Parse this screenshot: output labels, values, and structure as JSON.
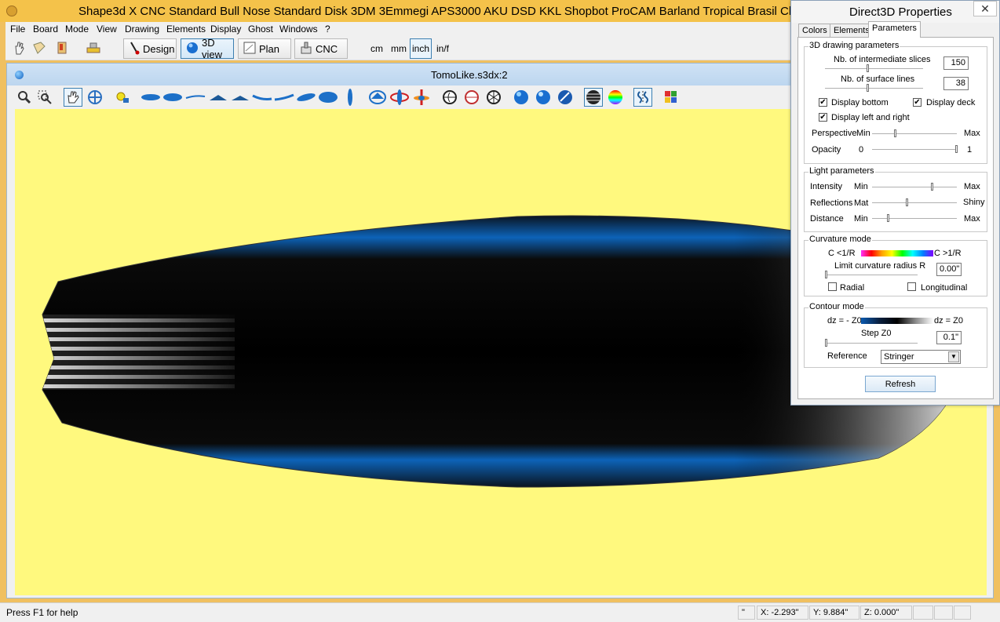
{
  "app": {
    "title": "Shape3d X CNC  Standard Bull Nose Standard Disk 3DM 3Emmegi APS3000 AKU DSD KKL Shopbot ProCAM Barland Tropical Brasil Channel Islands"
  },
  "menu": [
    "File",
    "Board",
    "Mode",
    "View",
    "Drawing",
    "Elements",
    "Display",
    "Ghost",
    "Windows",
    "?"
  ],
  "toolbar": {
    "design": "Design",
    "view3d": "3D view",
    "plan": "Plan",
    "cnc": "CNC",
    "units": [
      "cm",
      "mm",
      "inch",
      "in/f"
    ],
    "selected_unit": "inch"
  },
  "document": {
    "title": "TomoLike.s3dx:2"
  },
  "viewport": {
    "background": "#fff97e"
  },
  "status": {
    "help": "Press F1 for help",
    "unit_symbol": "\"",
    "x": "X: -2.293\"",
    "y": "Y: 9.884\"",
    "z": "Z: 0.000\""
  },
  "props": {
    "title": "Direct3D Properties",
    "close": "✕",
    "tabs": [
      "Colors",
      "Elements",
      "Parameters"
    ],
    "selected_tab": "Parameters",
    "drawing": {
      "title": "3D drawing parameters",
      "slices_label": "Nb. of intermediate slices",
      "slices_value": "150",
      "surface_label": "Nb. of surface lines",
      "surface_value": "38",
      "display_bottom": "Display bottom",
      "display_deck": "Display deck",
      "display_lr": "Display left and right",
      "check_mark": "✔",
      "perspective": "Perspective",
      "persp_min": "Min",
      "persp_max": "Max",
      "opacity": "Opacity",
      "opacity_min": "0",
      "opacity_max": "1"
    },
    "light": {
      "title": "Light parameters",
      "intensity": "Intensity",
      "reflections": "Reflections",
      "distance": "Distance",
      "min": "Min",
      "max": "Max",
      "mat": "Mat",
      "shiny": "Shiny"
    },
    "curvature": {
      "title": "Curvature mode",
      "low": "C <1/R",
      "high": "C >1/R",
      "limit_label": "Limit curvature radius R",
      "limit_value": "0.00\"",
      "radial": "Radial",
      "longitudinal": "Longitudinal"
    },
    "contour": {
      "title": "Contour mode",
      "low": "dz = - Z0",
      "high": "dz = Z0",
      "step_label": "Step Z0",
      "step_value": "0.1\"",
      "reference_label": "Reference",
      "reference_value": "Stringer"
    },
    "refresh": "Refresh"
  }
}
